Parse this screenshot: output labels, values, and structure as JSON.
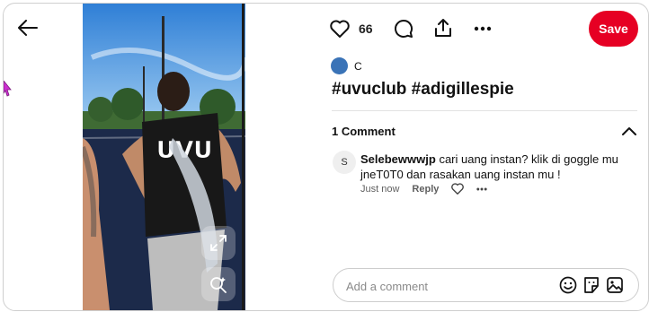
{
  "colors": {
    "brand": "#e60023",
    "author_avatar": "#3a73b7"
  },
  "pin": {
    "like_count": "66",
    "save_label": "Save",
    "author_name": "C",
    "title": "#uvuclub #adigillespie"
  },
  "icons": {
    "back": "arrow-left-icon",
    "like": "heart-icon",
    "comment": "comment-bubble-icon",
    "share": "share-upload-icon",
    "more": "more-dots-icon",
    "expand": "expand-icon",
    "visual_search": "visual-search-icon",
    "collapse": "chevron-up-icon"
  },
  "comments": {
    "header": "1 Comment",
    "items": [
      {
        "avatar_letter": "S",
        "username": "Selebewwwjp",
        "text": "cari uang instan? klik di goggle mu jneT0T0 dan rasakan uang instan mu !",
        "time": "Just now",
        "reply_label": "Reply"
      }
    ]
  },
  "add_comment": {
    "placeholder": "Add a comment"
  }
}
